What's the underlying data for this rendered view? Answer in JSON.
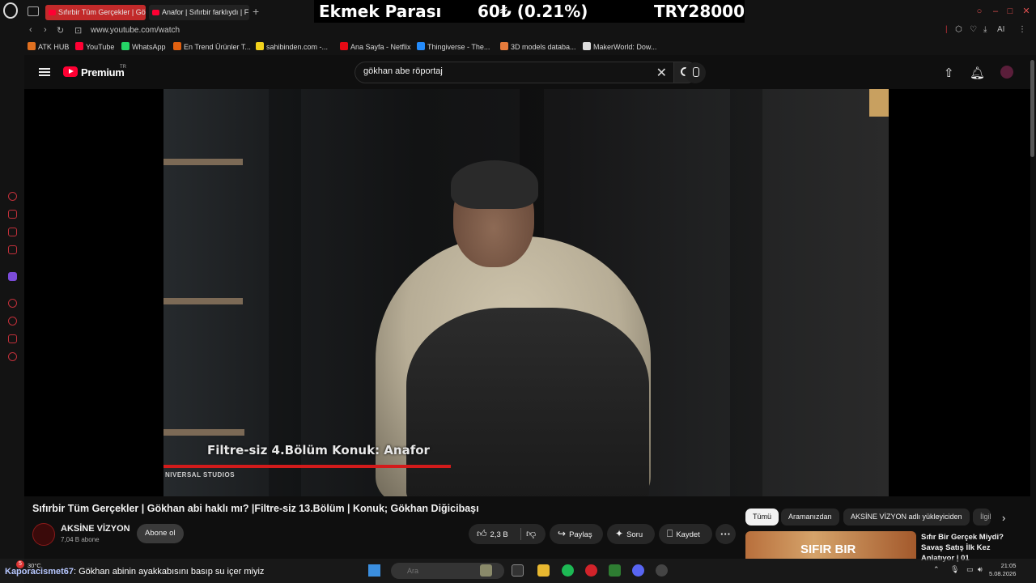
{
  "browser": {
    "tabs": [
      {
        "label": "Sıfırbir Tüm Gerçekler | Gö"
      },
      {
        "label": "Anafor | Sıfırbir farklıydı | F"
      }
    ],
    "url": "www.youtube.com/watch",
    "new_tab_label": "+"
  },
  "ticker": {
    "label": "Ekmek Parası",
    "change": "60₺ (0.21%)",
    "value": "TRY28000"
  },
  "bookmarks": [
    {
      "label": "ATK HUB",
      "color": "#e07020"
    },
    {
      "label": "YouTube",
      "color": "#ff0033"
    },
    {
      "label": "WhatsApp",
      "color": "#25d366"
    },
    {
      "label": "En Trend Ürünler T...",
      "color": "#e06010"
    },
    {
      "label": "sahibinden.com -...",
      "color": "#f2d21c"
    },
    {
      "label": "Ana Sayfa - Netflix",
      "color": "#e50914"
    },
    {
      "label": "Thingiverse - The...",
      "color": "#248bfb"
    },
    {
      "label": "3D models databa...",
      "color": "#e87c3c"
    },
    {
      "label": "MakerWorld: Dow...",
      "color": "#dddddd"
    }
  ],
  "extensions_label": "AI",
  "youtube": {
    "brand": "Premium",
    "region": "TR",
    "search_value": "gökhan abe röportaj",
    "video_overlay_caption": "Filtre-siz 4.Bölüm Konuk: Anafor",
    "video_overlay_studio": "NIVERSAL STUDIOS",
    "title": "Sıfırbir Tüm Gerçekler | Gökhan abi haklı mı? |Filtre-siz 13.Bölüm | Konuk; Gökhan Diğicibaşı",
    "channel": {
      "name": "AKSİNE VİZYON",
      "subscribers": "7,04 B abone",
      "subscribe_label": "Abone ol"
    },
    "actions": {
      "likes": "2,3 B",
      "share": "Paylaş",
      "ask": "Soru",
      "save": "Kaydet",
      "more": "···"
    },
    "chips": [
      "Tümü",
      "Aramanızdan",
      "AKSİNE VİZYON adlı yükleyiciden",
      "İlgili"
    ],
    "recommendation": {
      "title": "Sıfır Bir Gerçek Miydi? Savaş Satış İlk Kez Anlatıyor | 01",
      "thumb_text": "SIFIR BIR"
    }
  },
  "chat": {
    "user": "Kaporacismet67",
    "message": ": Gökhan abinin ayakkabısını basıp su içer miyiz"
  },
  "taskbar": {
    "weather": "30°C",
    "notifications": "5",
    "search_placeholder": "Ara",
    "time": "21:05",
    "date": "5.08.2026"
  },
  "colors": {
    "accent_red": "#ff0033",
    "tab_active": "#c22a2a",
    "sidebar_icons": "#c0303a"
  }
}
